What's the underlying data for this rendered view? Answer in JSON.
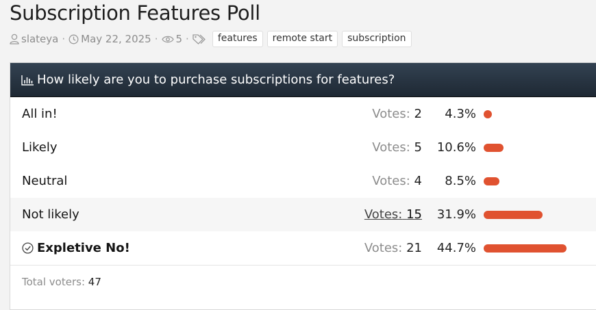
{
  "thread": {
    "title": "Subscription Features Poll",
    "author": "slateya",
    "date": "May 22, 2025",
    "views": "5",
    "tags": [
      "features",
      "remote start",
      "subscription"
    ]
  },
  "poll": {
    "question": "How likely are you to purchase subscriptions for features?",
    "votes_label": "Votes:",
    "options": [
      {
        "label": "All in!",
        "votes": "2",
        "percent": "4.3%",
        "fraction": 0.043
      },
      {
        "label": "Likely",
        "votes": "5",
        "percent": "10.6%",
        "fraction": 0.106
      },
      {
        "label": "Neutral",
        "votes": "4",
        "percent": "8.5%",
        "fraction": 0.085
      },
      {
        "label": "Not likely",
        "votes": "15",
        "percent": "31.9%",
        "fraction": 0.319
      },
      {
        "label": "Expletive No!",
        "votes": "21",
        "percent": "44.7%",
        "fraction": 0.447
      }
    ],
    "total_label": "Total voters:",
    "total": "47"
  },
  "colors": {
    "bar": "#e05230",
    "header_dark": "#1e2833"
  },
  "icons": {
    "author": "user-icon",
    "date": "clock-icon",
    "views": "eye-icon",
    "tags": "tags-icon",
    "poll": "bar-chart-icon",
    "voted": "check-circle-icon"
  }
}
